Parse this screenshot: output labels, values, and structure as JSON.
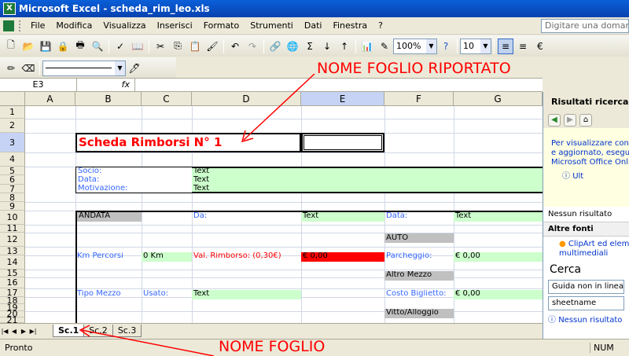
{
  "window": {
    "title": "Microsoft Excel - scheda_rim_leo.xls"
  },
  "menu": {
    "items": [
      "File",
      "Modifica",
      "Visualizza",
      "Inserisci",
      "Formato",
      "Strumenti",
      "Dati",
      "Finestra",
      "?"
    ],
    "help_placeholder": "Digitare una domanda"
  },
  "toolbar": {
    "zoom": "100%",
    "font_size": "10"
  },
  "formula": {
    "namebox": "E3",
    "fx": "fx",
    "value": ""
  },
  "columns": [
    "A",
    "B",
    "C",
    "D",
    "E",
    "F",
    "G"
  ],
  "rows": [
    "1",
    "2",
    "3",
    "4",
    "5",
    "6",
    "7",
    "8",
    "9",
    "10",
    "11",
    "12",
    "13",
    "14",
    "15",
    "16",
    "17",
    "18",
    "19",
    "20",
    "21"
  ],
  "cells": {
    "title": "Scheda Rimborsi N° 1",
    "socio": "Socio:",
    "data": "Data:",
    "motivazione": "Motivazione:",
    "text_socio": "Text",
    "text_data": "Text",
    "text_motiv": "Text",
    "andata": "ANDATA",
    "da": "Da:",
    "text_da": "Text",
    "data2": "Data:",
    "text_data2": "Text",
    "auto": "AUTO",
    "km_percorsi": "Km Percorsi",
    "km_value": "0 Km",
    "val_rimborso": "Val. Rimborso: (0,30€)",
    "rimborso_value": "€ 0,00",
    "parcheggio": "Parcheggio:",
    "parcheggio_value": "€ 0,00",
    "altro_mezzo": "Altro Mezzo",
    "tipo_mezzo": "Tipo Mezzo",
    "usato": "Usato:",
    "text_usato": "Text",
    "costo_biglietto": "Costo Biglietto:",
    "biglietto_value": "€ 0,00",
    "vitto": "Vitto/Alloggio"
  },
  "sheets": [
    "Sc.1",
    "Sc.2",
    "Sc.3"
  ],
  "status": {
    "left": "Pronto",
    "right": "NUM"
  },
  "taskpane": {
    "title": "Risultati ricerca",
    "info_lines": [
      "Per visualizzare cont",
      "e aggiornato, esegui",
      "Microsoft Office Onli"
    ],
    "info_link": "Ult",
    "no_results": "Nessun risultato",
    "other_sources": "Altre fonti",
    "clipart_lines": [
      "ClipArt ed elem",
      "multimediali"
    ],
    "search_header": "Cerca",
    "search_scope": "Guida non in linea",
    "search_text": "sheetname",
    "bottom_link": "Nessun risultato"
  },
  "annotations": {
    "sheet_name_reported": "NOME FOGLIO RIPORTATO",
    "sheet_name": "NOME FOGLIO"
  },
  "colors": {
    "green_fill": "#ccffcc",
    "grey_fill": "#c0c0c0",
    "red_fill": "#ff0000",
    "annotation": "#ff0000",
    "label_blue": "#3366ff"
  }
}
